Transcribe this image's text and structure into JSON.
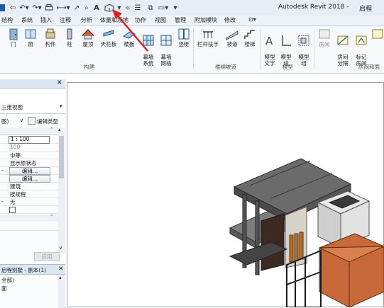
{
  "titlebar": {
    "app_title": "Autodesk Revit 2018 -",
    "doc_title_partial": "启程"
  },
  "quick_access": {
    "icons": [
      "revit-logo-icon",
      "open-icon",
      "save-icon",
      "undo-icon",
      "redo-icon",
      "print-icon",
      "measure-icon",
      "dimension-icon",
      "tag-icon",
      "text-icon",
      "3d-view-icon",
      "section-icon",
      "thin-lines-icon",
      "close-hidden-icon",
      "switch-windows-icon",
      "customize-icon"
    ],
    "text_glyph": "A"
  },
  "menu": {
    "tabs": [
      "结构",
      "系统",
      "插入",
      "注释",
      "分析",
      "体量和场地",
      "协作",
      "视图",
      "管理",
      "附加模块",
      "修改"
    ]
  },
  "ribbon": {
    "build_buttons": [
      "门",
      "窗",
      "构件",
      "柱",
      "屋顶",
      "天花板",
      "楼板",
      "幕墙\n系统",
      "幕墙\n网格",
      "竖梃"
    ],
    "build_label": "构建",
    "stairs_buttons": [
      "栏杆扶手",
      "坡道",
      "楼梯"
    ],
    "stairs_label": "楼梯坡道",
    "model_buttons": [
      "模型\n文字",
      "模型\n线",
      "模型\n组"
    ],
    "model_label": "模型",
    "room_buttons": [
      "房间",
      "房间\n分隔",
      "标记\n房间"
    ],
    "room_label": "房间和面"
  },
  "properties": {
    "type_label": "三维视图",
    "view_selector": "图)",
    "edit_type": "编辑类型",
    "rows": [
      {
        "value": "1 : 100",
        "kind": "input"
      },
      {
        "value": "100",
        "kind": "muted"
      },
      {
        "value": "中等",
        "kind": "text"
      },
      {
        "value": "显示原状态",
        "kind": "text"
      },
      {
        "value": "编辑...",
        "kind": "button"
      },
      {
        "value": "编辑...",
        "kind": "button"
      },
      {
        "value": "建筑",
        "kind": "text"
      },
      {
        "value": "按规程",
        "kind": "text"
      },
      {
        "value": "无",
        "kind": "text"
      },
      {
        "value": "",
        "kind": "checkbox"
      }
    ],
    "apply_label": "应用"
  },
  "browser": {
    "title": "启程别墅 - 副本(1)",
    "items": [
      "全部)",
      "面"
    ]
  },
  "colors": {
    "arrow": "#e02020",
    "roof": "#6b6b6b",
    "orange_block": "#c8693a",
    "wood": "#b07030"
  }
}
